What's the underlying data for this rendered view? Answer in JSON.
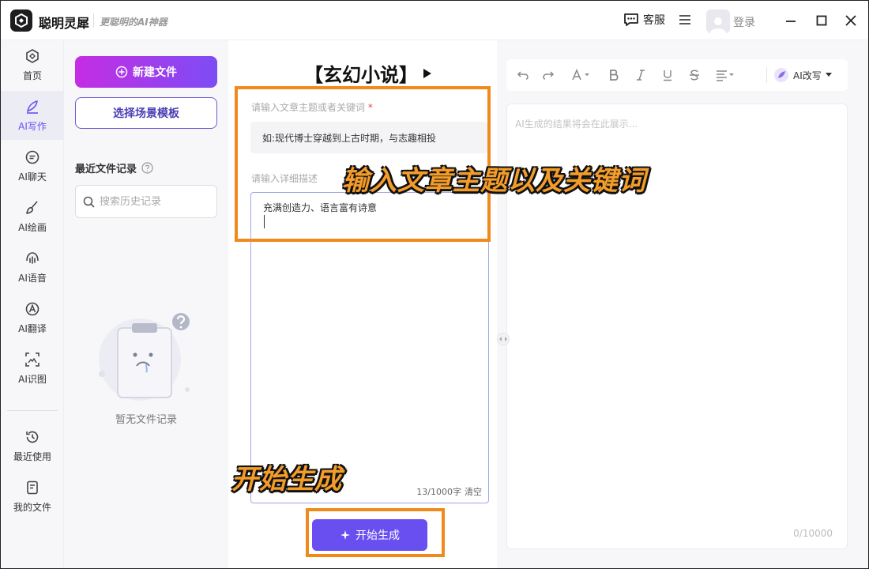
{
  "app": {
    "name": "聪明灵犀",
    "slogan": "更聪明的AI神器",
    "service_label": "客服",
    "login_label": "登录"
  },
  "nav": {
    "items": [
      {
        "label": "首页",
        "icon": "home-icon"
      },
      {
        "label": "AI写作",
        "icon": "pen-icon"
      },
      {
        "label": "AI聊天",
        "icon": "chat-icon"
      },
      {
        "label": "AI绘画",
        "icon": "brush-icon"
      },
      {
        "label": "AI语音",
        "icon": "voice-icon"
      },
      {
        "label": "AI翻译",
        "icon": "translate-icon"
      },
      {
        "label": "AI识图",
        "icon": "image-scan-icon"
      },
      {
        "label": "最近使用",
        "icon": "history-icon"
      },
      {
        "label": "我的文件",
        "icon": "file-icon"
      }
    ],
    "active_index": 1
  },
  "files": {
    "new_file_label": "新建文件",
    "template_label": "选择场景模板",
    "recent_title": "最近文件记录",
    "search_placeholder": "搜索历史记录",
    "empty_text": "暂无文件记录"
  },
  "editor": {
    "doc_title": "【玄幻小说】",
    "topic_label": "请输入文章主题或者关键词",
    "topic_required": "*",
    "topic_value": "如:现代博士穿越到上古时期，与志趣相投",
    "detail_label": "请输入详细描述",
    "detail_value": "充满创造力、语言富有诗意",
    "char_count": "13/1000字",
    "clear_label": "清空",
    "generate_label": "开始生成"
  },
  "annotations": {
    "topic_hint": "输入文章主题以及关键词",
    "generate_hint": "开始生成",
    "highlight_color": "#f08a1c"
  },
  "output": {
    "ai_rewrite_label": "AI改写",
    "placeholder": "AI生成的结果将会在此展示...",
    "char_count": "0/10000"
  },
  "colors": {
    "accent": "#6a4ff0",
    "gradient_start": "#c52de3",
    "gradient_end": "#7d4cf5"
  }
}
